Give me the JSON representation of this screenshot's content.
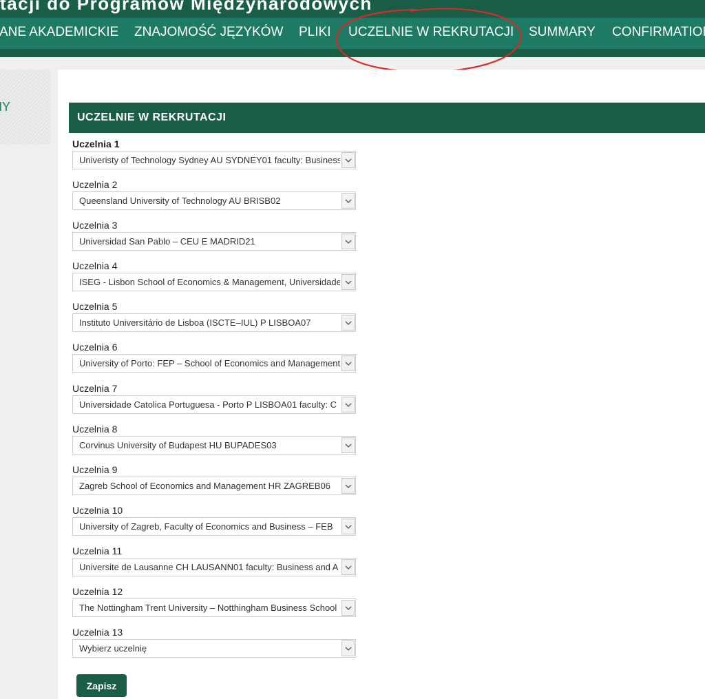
{
  "header": {
    "title": "tacji do Programów Międzynarodowych"
  },
  "nav": {
    "items": [
      {
        "label": "ANE AKADEMICKIE"
      },
      {
        "label": "ZNAJOMOŚĆ JĘZYKÓW"
      },
      {
        "label": "PLIKI"
      },
      {
        "label": "UCZELNIE W REKRUTACJI"
      },
      {
        "label": "SUMMARY"
      },
      {
        "label": "CONFIRMATION"
      }
    ]
  },
  "sidebar": {
    "text": "MY"
  },
  "section": {
    "title": "UCZELNIE W REKRUTACJI"
  },
  "fields": [
    {
      "label": "Uczelnia 1",
      "value": "Univeristy of Technology Sydney AU SYDNEY01 faculty: Business"
    },
    {
      "label": "Uczelnia 2",
      "value": "Queensland University of Technology AU BRISB02"
    },
    {
      "label": "Uczelnia 3",
      "value": "Universidad San Pablo – CEU E MADRID21"
    },
    {
      "label": "Uczelnia 4",
      "value": "ISEG - Lisbon School of Economics & Management, Universidade"
    },
    {
      "label": "Uczelnia 5",
      "value": "Instituto Universitário de Lisboa (ISCTE–IUL) P LISBOA07"
    },
    {
      "label": "Uczelnia 6",
      "value": "University of Porto: FEP – School of Economics and Management"
    },
    {
      "label": "Uczelnia 7",
      "value": "Universidade Catolica Portuguesa - Porto P LISBOA01 faculty: C"
    },
    {
      "label": "Uczelnia 8",
      "value": "Corvinus University of Budapest HU BUPADES03"
    },
    {
      "label": "Uczelnia 9",
      "value": "Zagreb School of Economics and Management HR ZAGREB06"
    },
    {
      "label": "Uczelnia 10",
      "value": "University of Zagreb, Faculty of Economics and Business – FEB"
    },
    {
      "label": "Uczelnia 11",
      "value": "Universite de Lausanne CH LAUSANN01 faculty: Business and A"
    },
    {
      "label": "Uczelnia 12",
      "value": "The Nottingham Trent University – Notthingham Business School"
    },
    {
      "label": "Uczelnia 13",
      "value": "Wybierz uczelnię"
    }
  ],
  "actions": {
    "save_label": "Zapisz"
  },
  "colors": {
    "header_dark": "#1b5e47",
    "nav_green": "#1e7a62",
    "annotation_red": "#d42a2a"
  }
}
